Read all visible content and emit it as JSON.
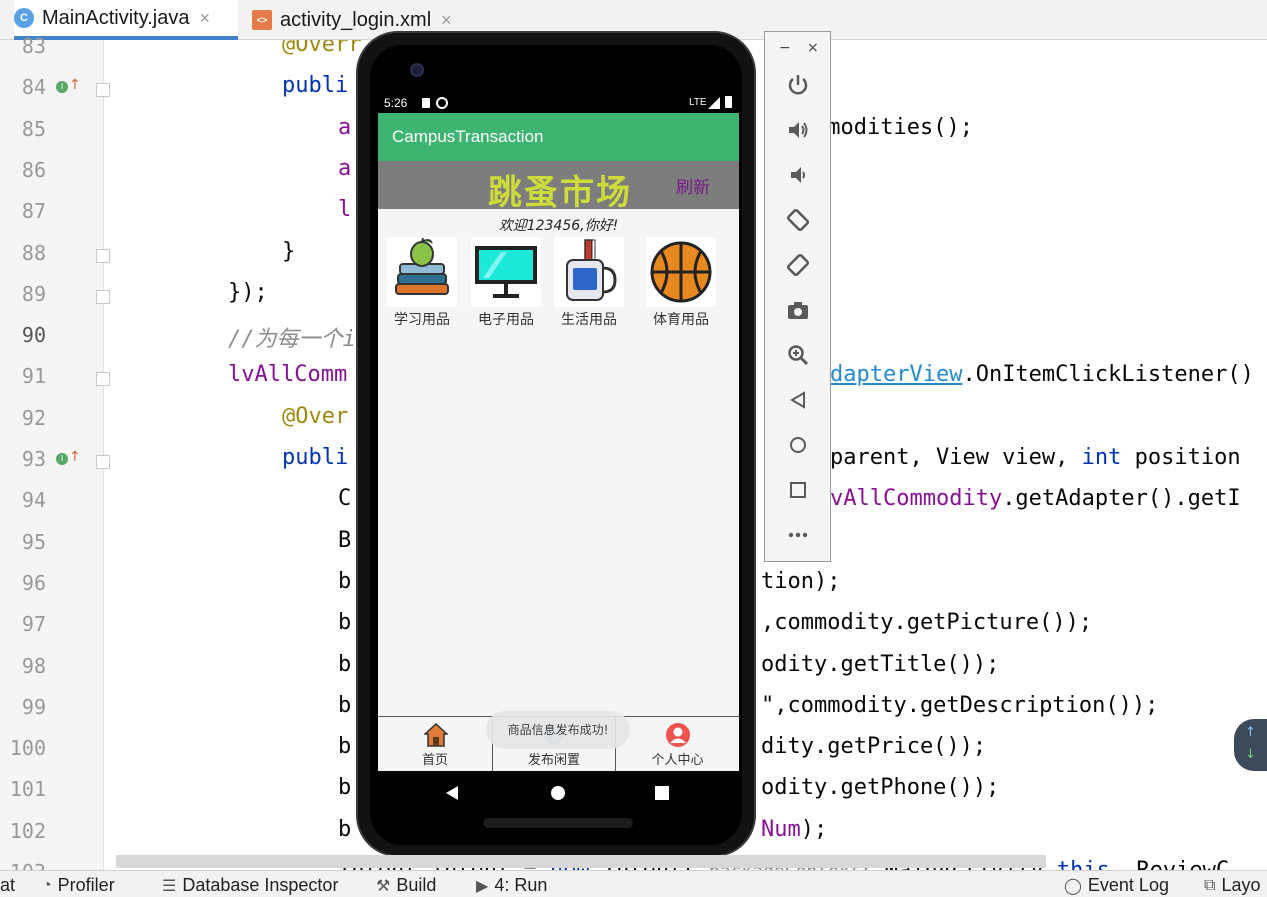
{
  "tabs": [
    {
      "label": "MainActivity.java",
      "icon": "java-class-icon",
      "active": true
    },
    {
      "label": "activity_login.xml",
      "icon": "xml-file-icon",
      "active": false
    }
  ],
  "editor": {
    "current_line": "90",
    "lines": [
      {
        "n": "83",
        "tokens": [
          {
            "t": "@Overr",
            "c": "ann"
          }
        ]
      },
      {
        "n": "84",
        "tokens": [
          {
            "t": "publi",
            "c": "kw"
          }
        ]
      },
      {
        "n": "85",
        "tokens": [
          {
            "t": "a",
            "c": "fld"
          },
          {
            "t": "                      mmodities();",
            "c": ""
          }
        ]
      },
      {
        "n": "86",
        "tokens": [
          {
            "t": "a",
            "c": "fld"
          }
        ]
      },
      {
        "n": "87",
        "tokens": [
          {
            "t": "l",
            "c": "fld"
          }
        ]
      },
      {
        "n": "88",
        "tokens": [
          {
            "t": "}",
            "c": ""
          }
        ]
      },
      {
        "n": "89",
        "tokens": [
          {
            "t": "});",
            "c": ""
          }
        ]
      },
      {
        "n": "90",
        "tokens": [
          {
            "t": "//为每一个i",
            "c": "cm"
          }
        ]
      },
      {
        "n": "91",
        "tokens": [
          {
            "t": "lvAllComm",
            "c": "fld"
          }
        ]
      },
      {
        "n": "92",
        "tokens": [
          {
            "t": "@Over",
            "c": "ann"
          }
        ]
      },
      {
        "n": "93",
        "tokens": [
          {
            "t": "publi",
            "c": "kw"
          }
        ]
      },
      {
        "n": "94",
        "tokens": [
          {
            "t": "C",
            "c": ""
          }
        ]
      },
      {
        "n": "95",
        "tokens": [
          {
            "t": "B",
            "c": ""
          }
        ]
      },
      {
        "n": "96",
        "tokens": [
          {
            "t": "b",
            "c": ""
          }
        ]
      },
      {
        "n": "97",
        "tokens": [
          {
            "t": "b",
            "c": ""
          }
        ]
      },
      {
        "n": "98",
        "tokens": [
          {
            "t": "b",
            "c": ""
          }
        ]
      },
      {
        "n": "99",
        "tokens": [
          {
            "t": "b",
            "c": ""
          }
        ]
      },
      {
        "n": "100",
        "tokens": [
          {
            "t": "b",
            "c": ""
          }
        ]
      },
      {
        "n": "101",
        "tokens": [
          {
            "t": "b",
            "c": ""
          }
        ]
      },
      {
        "n": "102",
        "tokens": [
          {
            "t": "b",
            "c": ""
          }
        ]
      },
      {
        "n": "103",
        "tokens": [
          {
            "t": "Intent intent = ",
            "c": ""
          },
          {
            "t": "new",
            "c": "kw"
          },
          {
            "t": " Intent( ",
            "c": ""
          },
          {
            "t": "packageContext:",
            "c": "hint"
          },
          {
            "t": " MainActivity.",
            "c": ""
          },
          {
            "t": "this",
            "c": "kw"
          },
          {
            "t": ", ReviewC",
            "c": ""
          }
        ]
      }
    ],
    "right_fragments": [
      {
        "line": "85",
        "text": "mmodities();",
        "c": ""
      },
      {
        "line": "91",
        "text": "dapterView",
        "c": "lnk"
      },
      {
        "line": "91",
        "text": ".OnItemClickListener()",
        "c": ""
      },
      {
        "line": "93",
        "text": "parent, View view, ",
        "c": ""
      },
      {
        "line": "93",
        "text": "int",
        "c": "kw"
      },
      {
        "line": "93",
        "text": " position",
        "c": ""
      },
      {
        "line": "94",
        "text": "vAllCommodity",
        "c": "fld"
      },
      {
        "line": "94",
        "text": ".getAdapter().getI",
        "c": ""
      },
      {
        "line": "96",
        "text": "tion);",
        "c": ""
      },
      {
        "line": "97",
        "text": ",commodity.getPicture());",
        "c": ""
      },
      {
        "line": "98",
        "text": "odity.getTitle());",
        "c": ""
      },
      {
        "line": "99",
        "text": "\",commodity.getDescription());",
        "c": ""
      },
      {
        "line": "100",
        "text": "dity.getPrice());",
        "c": ""
      },
      {
        "line": "101",
        "text": "odity.getPhone());",
        "c": ""
      },
      {
        "line": "102",
        "text": "Num",
        "c": "fld"
      },
      {
        "line": "102",
        "text": ");",
        "c": ""
      }
    ]
  },
  "phone": {
    "status": {
      "time": "5:26",
      "network": "LTE"
    },
    "app_title": "CampusTransaction",
    "banner_title": "跳蚤市场",
    "refresh_label": "刷新",
    "welcome": "欢迎123456,你好!",
    "categories": [
      {
        "label": "学习用品",
        "icon": "books-apple-icon"
      },
      {
        "label": "电子用品",
        "icon": "monitor-icon"
      },
      {
        "label": "生活用品",
        "icon": "mug-toothbrush-icon"
      },
      {
        "label": "体育用品",
        "icon": "basketball-icon"
      }
    ],
    "bottom_nav": [
      {
        "label": "首页",
        "icon": "home-icon"
      },
      {
        "label": "发布闲置",
        "icon": "publish-icon"
      },
      {
        "label": "个人中心",
        "icon": "person-icon"
      }
    ],
    "toast": "商品信息发布成功!"
  },
  "emulator_toolbar": {
    "window_controls": [
      "−",
      "×"
    ],
    "buttons": [
      "power-icon",
      "volume-up-icon",
      "volume-down-icon",
      "rotate-left-icon",
      "rotate-right-icon",
      "camera-icon",
      "zoom-icon",
      "back-icon",
      "home-icon",
      "overview-icon",
      "more-icon"
    ]
  },
  "toolstrip": [
    {
      "label": "at",
      "icon": ""
    },
    {
      "label": "Profiler",
      "icon": "profiler-icon"
    },
    {
      "label": "Database Inspector",
      "icon": "database-icon"
    },
    {
      "label": "Build",
      "icon": "hammer-icon"
    },
    {
      "label": "4: Run",
      "icon": "run-icon"
    },
    {
      "label": "Event Log",
      "icon": "event-log-icon"
    },
    {
      "label": "Layo",
      "icon": "layout-inspector-icon"
    }
  ],
  "colors": {
    "app_bar": "#3eb472",
    "banner_bg": "#7d7d7d",
    "banner_title": "#cddc39",
    "refresh": "#7a1a8a",
    "keyword": "#0033b3",
    "field": "#871094",
    "annotation": "#9e880d"
  }
}
